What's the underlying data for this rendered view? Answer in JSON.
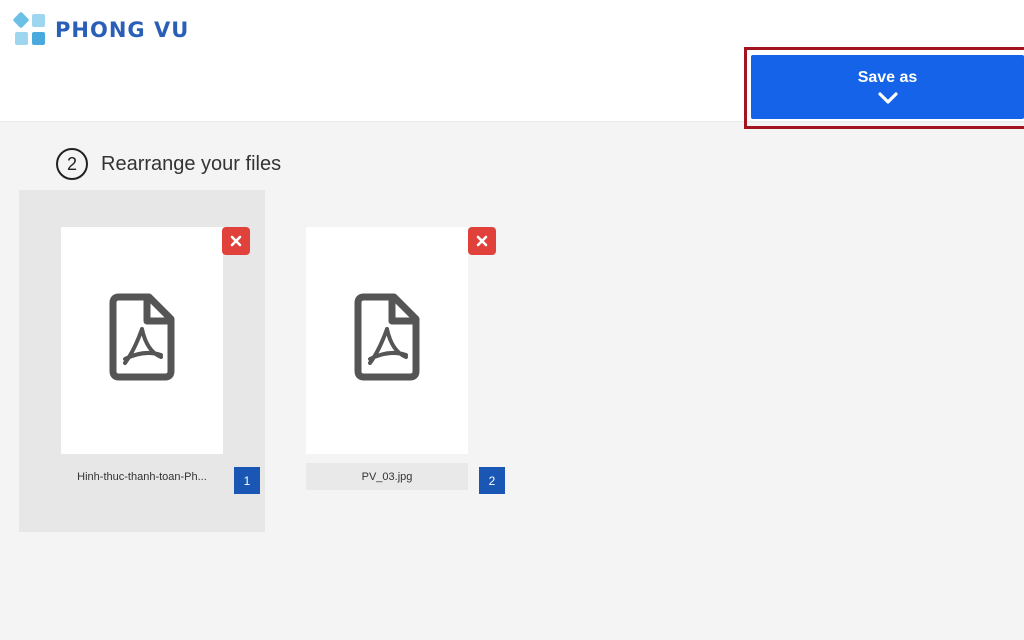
{
  "brand": {
    "name": "PHONG VU",
    "colors": {
      "text": "#2a5fb8",
      "light": "#6cc0e6",
      "mid": "#4aa9dd"
    }
  },
  "toolbar": {
    "save_label": "Save as",
    "save_icon": "chevron-down-icon",
    "button_color": "#1463e8",
    "highlight_color": "#a31420"
  },
  "step": {
    "number": "2",
    "title": "Rearrange your files"
  },
  "files": [
    {
      "name": "Hinh-thuc-thanh-toan-Ph...",
      "order": "1",
      "icon": "pdf-file-icon",
      "remove_icon": "close-icon"
    },
    {
      "name": "PV_03.jpg",
      "order": "2",
      "icon": "pdf-file-icon",
      "remove_icon": "close-icon"
    }
  ]
}
